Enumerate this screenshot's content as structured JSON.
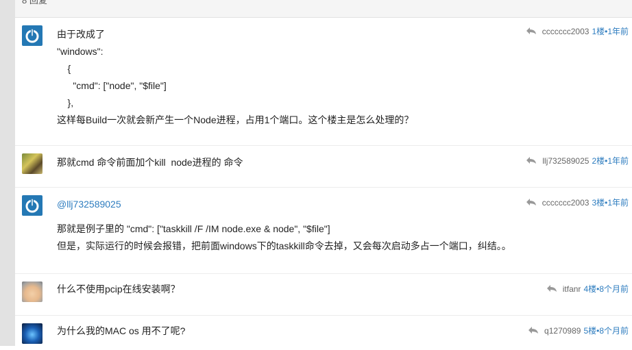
{
  "header": {
    "count_label": "8 回复"
  },
  "replies": [
    {
      "user": "ccccccc2003",
      "floor_time": "1楼•1年前",
      "lines": [
        "由于改成了",
        "\"windows\":",
        "    {",
        "      \"cmd\": [\"node\", \"$file\"]",
        "    },",
        "这样每Build一次就会新产生一个Node进程，占用1个端口。这个楼主是怎么处理的？"
      ]
    },
    {
      "user": "llj732589025",
      "floor_time": "2楼•1年前",
      "lines": [
        "那就cmd 命令前面加个kill  node进程的 命令"
      ]
    },
    {
      "user": "ccccccc2003",
      "floor_time": "3楼•1年前",
      "mention": "@llj732589025",
      "lines": [
        "那就是例子里的 \"cmd\": [\"taskkill /F /IM node.exe & node\", \"$file\"]",
        "但是，实际运行的时候会报错，把前面windows下的taskkill命令去掉，又会每次启动多占一个端口，纠结。。"
      ]
    },
    {
      "user": "itfanr",
      "floor_time": "4楼•8个月前",
      "lines": [
        "什么不使用pcip在线安装啊？"
      ]
    },
    {
      "user": "q1270989",
      "floor_time": "5楼•8个月前",
      "lines": [
        "为什么我的MAC os 用不了呢?"
      ]
    }
  ]
}
